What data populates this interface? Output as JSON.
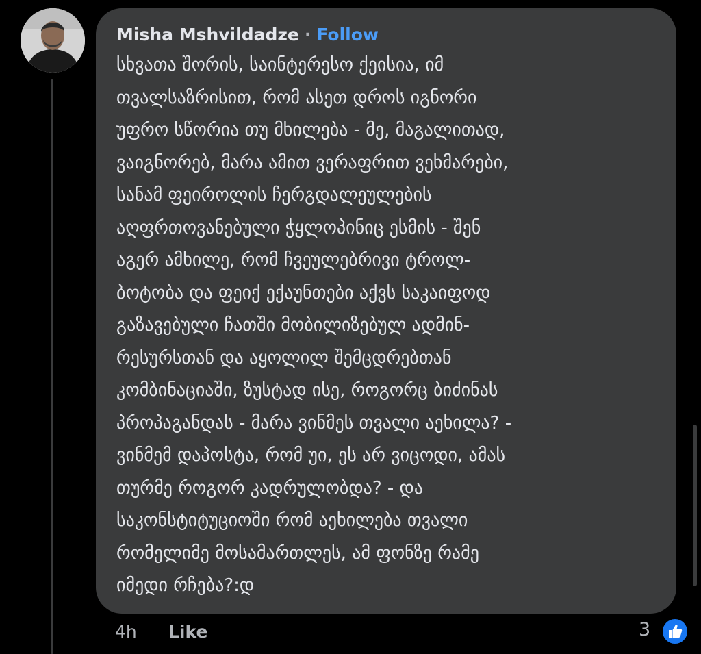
{
  "comment": {
    "author": "Misha Mshvildadze",
    "separator": "·",
    "follow_label": "Follow",
    "text_lines": [
      "სხვათა შორის, საინტერესო ქეისია, იმ",
      "თვალსაზრისით, რომ ასეთ დროს იგნორი",
      "უფრო სწორია თუ მხილება - მე, მაგალითად,",
      "ვაიგნორებ, მარა ამით ვერაფრით ვეხმარები,",
      "სანამ ფეიროლის ჩერგდალეულების",
      "აღფრთოვანებული ჭყლოპინიც ესმის - შენ",
      "აგერ ამხილე, რომ ჩვეულებრივი ტროლ-",
      "ბოტობა და ფეიქ ექაუნთები აქვს საკაიფოდ",
      "გაზავებული ჩათში მობილიზებულ ადმინ-",
      "რესურსთან და აყოლილ შემცდრებთან",
      "კომბინაციაში, ზუსტად ისე, როგორც ბიძინას",
      "პროპაგანდას - მარა ვინმეს თვალი აეხილა? -",
      "ვინმემ დაპოსტა, რომ უი, ეს არ ვიცოდი, ამას",
      "თურმე როგორ კადრულობდა? - და",
      "საკონსტიტუციოში რომ აეხილება თვალი",
      "რომელიმე მოსამართლეს, ამ ფონზე რამე",
      "იმედი რჩება?:დ"
    ],
    "time": "4h",
    "like_label": "Like",
    "reaction_count": "3",
    "reaction_icon": "thumbs-up-icon"
  },
  "colors": {
    "background": "#000000",
    "bubble": "#3a3b3c",
    "text": "#e4e6eb",
    "muted": "#b0b3b8",
    "accent": "#4b9cf7",
    "reaction": "#1877f2"
  }
}
